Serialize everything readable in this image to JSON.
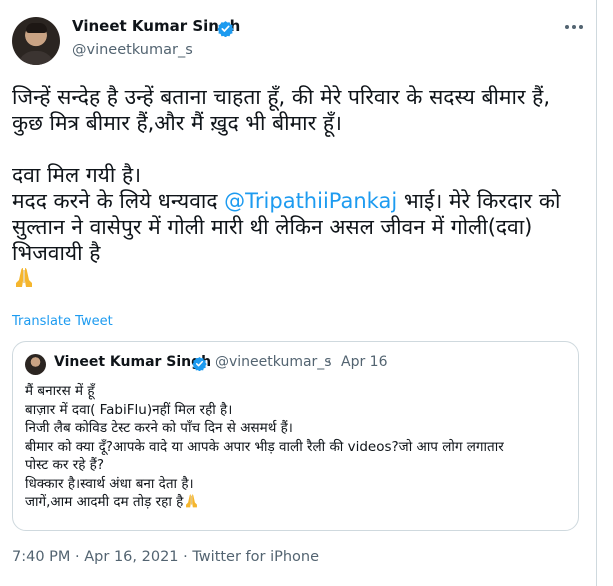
{
  "tweet": {
    "author": {
      "name": "Vineet Kumar Singh",
      "handle": "@vineetkumar_s"
    },
    "text_lines": [
      "जिन्हें सन्देह है उन्हें बताना चाहता हूँ, की मेरे परिवार के सदस्य बीमार हैं,",
      "कुछ मित्र बीमार हैं,और मैं ख़ुद भी बीमार हूँ।",
      "दवा मिल गयी है।",
      "मदद करने के लिये धन्यवाद ",
      "@TripathiiPankaj",
      " भाई। मेरे किरदार को",
      "सुल्तान ने वासेपुर में गोली मारी थी लेकिन असल जीवन में गोली(दवा)",
      "भिजवायी है"
    ],
    "translate_label": "Translate Tweet",
    "timestamp": "7:40 PM · Apr 16, 2021 · Twitter for iPhone"
  },
  "quoted": {
    "name": "Vineet Kumar Singh",
    "handle": "@vineetkumar_s",
    "separator": "·",
    "date": "Apr 16",
    "lines": [
      "मैं बनारस में हूँ",
      "बाज़ार में दवा( FabiFlu)नहीं मिल रही है।",
      "निजी लैब कोविड टेस्ट करने को पाँच दिन से असमर्थ हैं।",
      "बीमार को क्या दूँ?आपके वादे या आपके अपार भीड़ वाली रैली की videos?जो आप लोग लगातार",
      "पोस्ट कर रहे हैं?",
      "धिक्कार है।स्वार्थ अंधा बना देता है।",
      "जागें,आम आदमी दम तोड़ रहा है"
    ]
  },
  "colors": {
    "accent": "#1d9bf0",
    "secondary_text": "#536471",
    "border": "#cfd9de",
    "emoji": "#f5b62e"
  },
  "icons": {
    "verified": "verified-badge-icon",
    "more": "more-options-icon",
    "emoji": "folded-hands-emoji"
  }
}
